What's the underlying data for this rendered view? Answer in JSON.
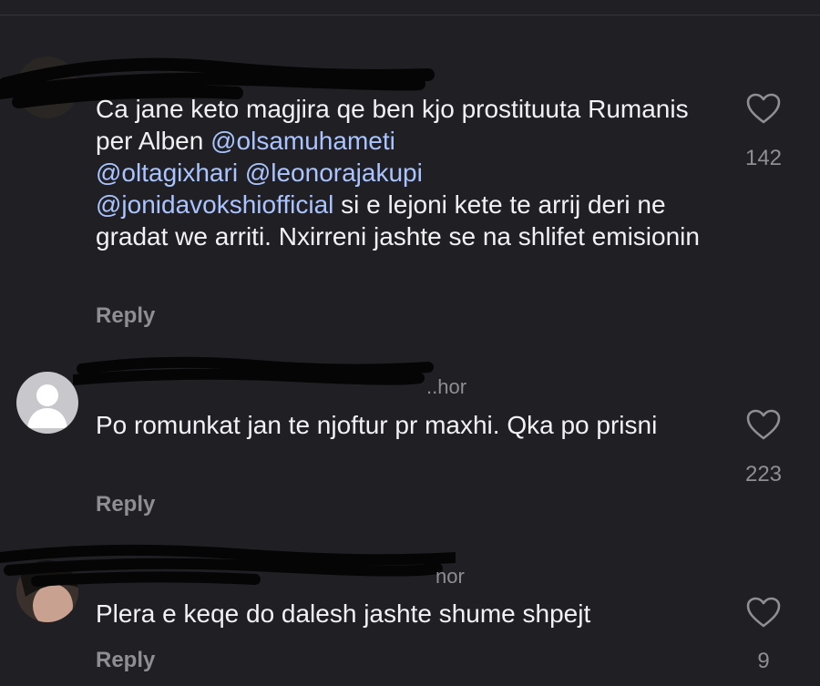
{
  "comments": [
    {
      "meta": "",
      "text_plain_before": "Ca jane keto magjira qe ben kjo prostituuta Rumanis per Alben ",
      "mentions": [
        "@olsamuhameti",
        "@oltagixhari",
        "@leonorajakupi",
        "@jonidavokshiofficial"
      ],
      "text_plain_after": " si e lejoni kete te arrij deri ne gradat we arriti. Nxirreni jashte se na shlifet emisionin",
      "reply_label": "Reply",
      "likes": "142",
      "like_icon": "heart-outline-icon"
    },
    {
      "meta": "..hor",
      "text": "Po romunkat jan te njoftur pr maxhi. Qka po prisni",
      "reply_label": "Reply",
      "likes": "223",
      "like_icon": "heart-outline-icon"
    },
    {
      "meta": "nor",
      "text": "Plera e keqe do dalesh jashte shume shpejt",
      "reply_label": "Reply",
      "likes": "9",
      "like_icon": "heart-outline-icon"
    }
  ],
  "colors": {
    "background": "#1f1f24",
    "text": "#f2f2f5",
    "secondary": "#8e8e93",
    "mention": "#a9c4ff"
  }
}
